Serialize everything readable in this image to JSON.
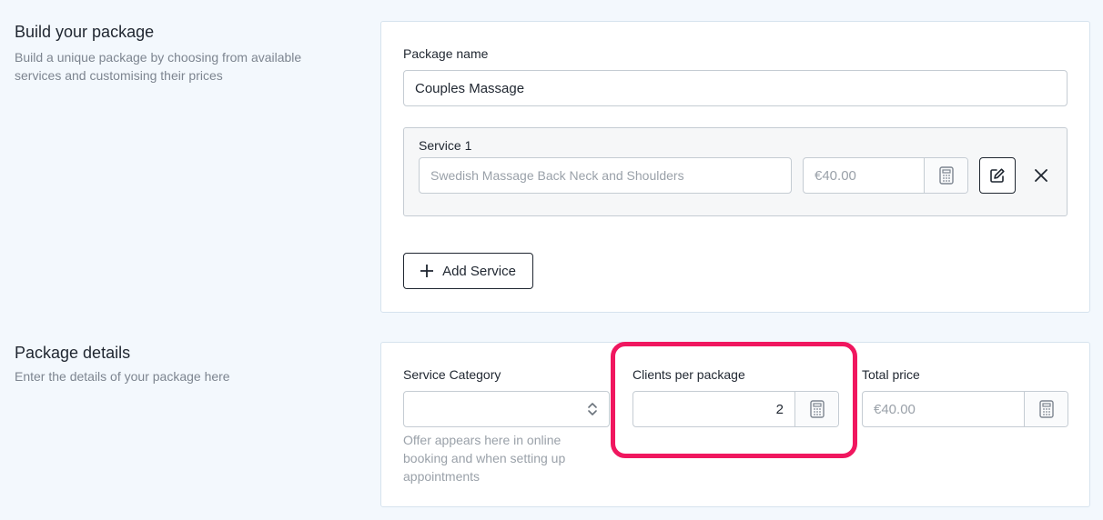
{
  "build": {
    "title": "Build your package",
    "description": "Build a unique package by choosing from available services and customising their prices",
    "package_name_label": "Package name",
    "package_name_value": "Couples Massage",
    "service": {
      "label": "Service 1",
      "name_placeholder": "Swedish Massage Back Neck and Shoulders",
      "price_placeholder": "€40.00"
    },
    "add_service_label": "Add Service"
  },
  "details": {
    "title": "Package details",
    "description": "Enter the details of your package here",
    "category_label": "Service Category",
    "category_value": "",
    "category_hint": "Offer appears here in online booking and when setting up appointments",
    "clients_label": "Clients per package",
    "clients_value": "2",
    "total_label": "Total price",
    "total_placeholder": "€40.00"
  },
  "colors": {
    "highlight": "#f0175f",
    "background": "#f3f8fd"
  }
}
